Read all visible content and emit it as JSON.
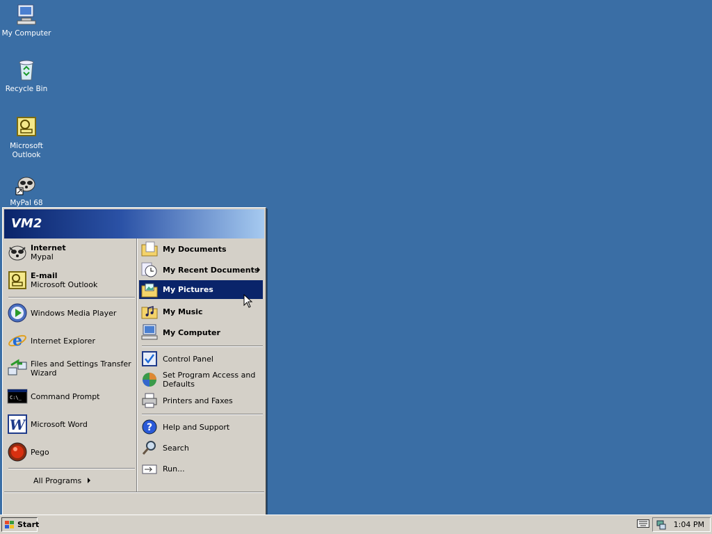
{
  "desktop": {
    "icons": [
      {
        "label": "My Computer"
      },
      {
        "label": "Recycle Bin"
      },
      {
        "label": "Microsoft Outlook"
      },
      {
        "label": "MyPal 68"
      }
    ]
  },
  "start_menu": {
    "user": "VM2",
    "pinned": [
      {
        "title": "Internet",
        "subtitle": "Mypal"
      },
      {
        "title": "E-mail",
        "subtitle": "Microsoft Outlook"
      }
    ],
    "recent": [
      {
        "label": "Windows Media Player"
      },
      {
        "label": "Internet Explorer"
      },
      {
        "label": "Files and Settings Transfer Wizard"
      },
      {
        "label": "Command Prompt"
      },
      {
        "label": "Microsoft Word"
      },
      {
        "label": "Pego"
      }
    ],
    "all_programs": "All Programs",
    "right": [
      {
        "label": "My Documents"
      },
      {
        "label": "My Recent Documents"
      },
      {
        "label": "My Pictures"
      },
      {
        "label": "My Music"
      },
      {
        "label": "My Computer"
      },
      {
        "label": "Control Panel"
      },
      {
        "label": "Set Program Access and Defaults"
      },
      {
        "label": "Printers and Faxes"
      },
      {
        "label": "Help and Support"
      },
      {
        "label": "Search"
      },
      {
        "label": "Run..."
      }
    ],
    "selected": "My Pictures"
  },
  "taskbar": {
    "start_label": "Start",
    "clock": "1:04 PM"
  },
  "colors": {
    "desktop": "#3a6ea5",
    "selection": "#0a246a",
    "face": "#d4d0c8"
  }
}
